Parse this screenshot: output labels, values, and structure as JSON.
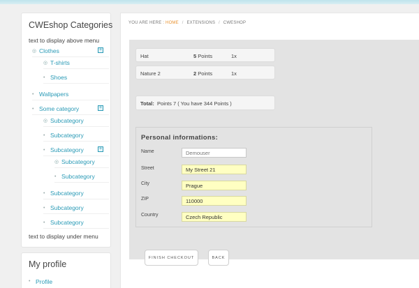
{
  "sidebar": {
    "title": "CWEshop Categories",
    "above_text": "text to display above menu",
    "below_text": "text to display under menu",
    "items": {
      "clothes": "Clothes",
      "tshirts": "T-shirts",
      "shoes": "Shoes",
      "wallpapers": "Wallpapers",
      "some_category": "Some category",
      "sub1": "Subcategory",
      "sub2": "Subcategory",
      "sub3": "Subcategory",
      "sub3a": "Subcategory",
      "sub3b": "Subcategory",
      "sub4": "Subcategory",
      "sub5": "Subcategory",
      "sub6": "Subcategory"
    },
    "expand_glyph": "+"
  },
  "profile": {
    "title": "My profile",
    "link": "Profile"
  },
  "breadcrumb": {
    "prefix": "YOU ARE HERE :",
    "home": "HOME",
    "sep": "/",
    "extensions": "EXTENSIONS",
    "current": "CWESHOP"
  },
  "cart": {
    "items": [
      {
        "name": "Hat",
        "points": "5",
        "points_label": "Points",
        "qty": "1x"
      },
      {
        "name": "Nature 2",
        "points": "2",
        "points_label": "Points",
        "qty": "1x"
      }
    ],
    "total_label": "Total:",
    "total_text": "Points 7 ( You have 344 Points )"
  },
  "form": {
    "title": "Personal informations:",
    "name_label": "Name",
    "name_placeholder": "Demouser",
    "street_label": "Street",
    "street_value": "My Street 21",
    "city_label": "City",
    "city_value": "Prague",
    "zip_label": "ZIP",
    "zip_value": "110000",
    "country_label": "Country",
    "country_value": "Czech Republic"
  },
  "buttons": {
    "finish": "FINISH CHECKOUT",
    "back": "BACK"
  }
}
